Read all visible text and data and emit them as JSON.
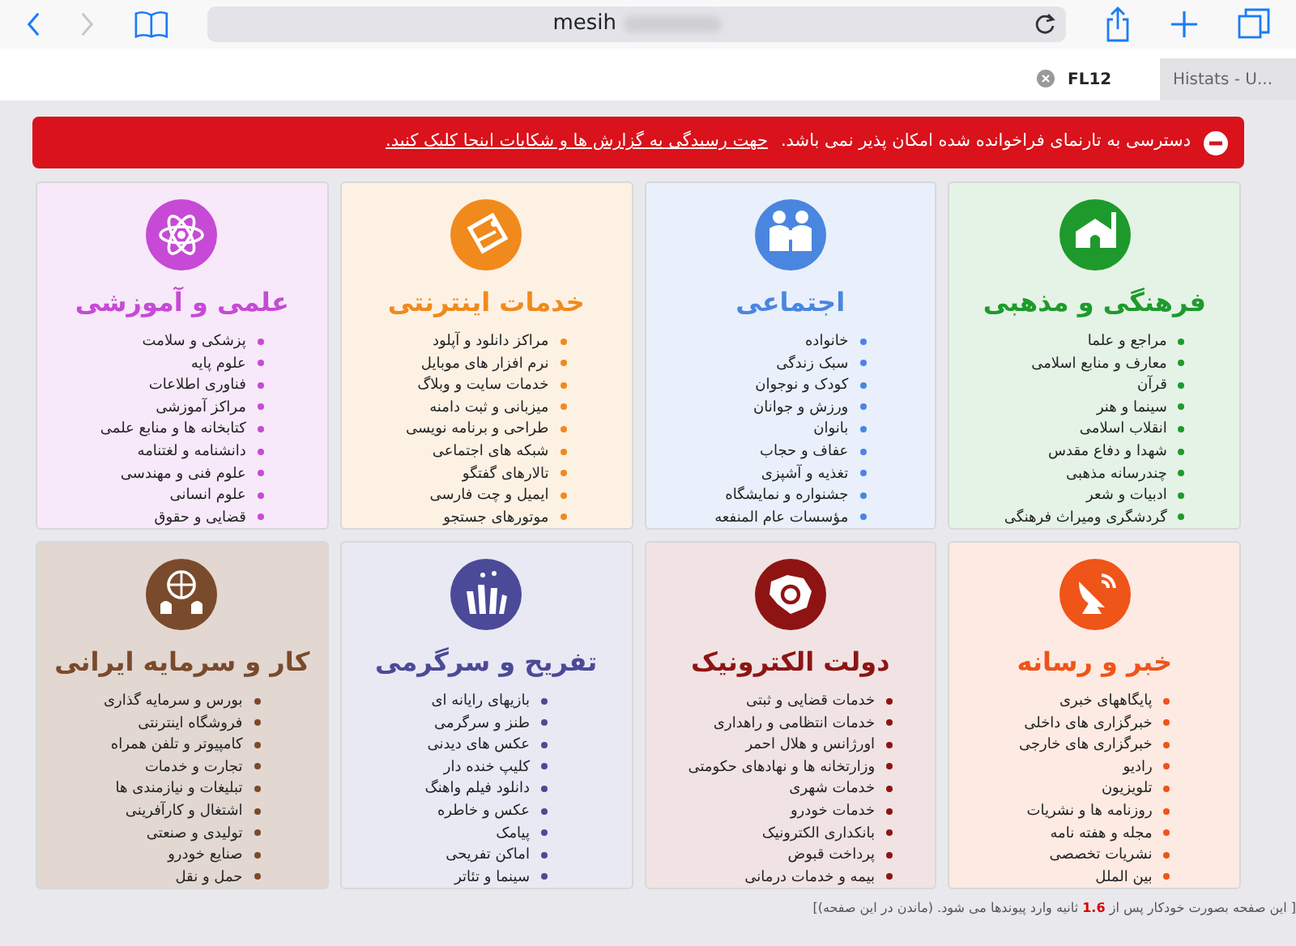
{
  "browser": {
    "back": {
      "disabled": false
    },
    "forward": {
      "disabled": true
    },
    "address": "mesih",
    "tabs": [
      {
        "label": "Histats - U...",
        "selected": false
      },
      {
        "label": "FL12",
        "selected": true
      }
    ]
  },
  "alert": {
    "text": "دسترسی به تارنمای فراخوانده شده امکان پذیر نمی باشد.",
    "link": "جهت رسیدگی به گزارش ها و شکایات اینجا کلیک کنید."
  },
  "categories": [
    {
      "title": "فرهنگی و مذهبی",
      "color": "#1e9a2c",
      "items": [
        "مراجع و علما",
        "معارف و منابع اسلامی",
        "قرآن",
        "سینما و هنر",
        "انقلاب اسلامی",
        "شهدا و دفاع مقدس",
        "چندرسانه مذهبی",
        "ادبیات و شعر",
        "گردشگری ومیراث فرهنگی"
      ]
    },
    {
      "title": "اجتماعی",
      "color": "#4a86df",
      "items": [
        "خانواده",
        "سبک زندگی",
        "کودک و نوجوان",
        "ورزش و جوانان",
        "بانوان",
        "عفاف و حجاب",
        "تغذیه و آشپزی",
        "جشنواره و نمایشگاه",
        "مؤسسات عام المنفعه"
      ]
    },
    {
      "title": "خدمات اینترنتی",
      "color": "#f08a1c",
      "items": [
        "مراکز دانلود و آپلود",
        "نرم افزار های موبایل",
        "خدمات سایت و وبلاگ",
        "میزبانی و ثبت دامنه",
        "طراحی و برنامه نویسی",
        "شبکه های اجتماعی",
        "تالارهای گفتگو",
        "ایمیل و چت فارسی",
        "موتورهای جستجو"
      ]
    },
    {
      "title": "علمی و آموزشی",
      "color": "#c64ad6",
      "items": [
        "پزشکی و سلامت",
        "علوم پایه",
        "فناوری اطلاعات",
        "مراکز آموزشی",
        "کتابخانه ها و منابع علمی",
        "دانشنامه و لغتنامه",
        "علوم فنی و مهندسی",
        "علوم انسانی",
        "قضایی و حقوق"
      ]
    },
    {
      "title": "خبر و رسانه",
      "color": "#ef5418",
      "items": [
        "پایگاههای خبری",
        "خبرگزاری های داخلی",
        "خبرگزاری های خارجی",
        "رادیو",
        "تلویزیون",
        "روزنامه ها و نشریات",
        "مجله و هفته نامه",
        "نشریات تخصصی",
        "بین الملل"
      ]
    },
    {
      "title": "دولت الکترونیک",
      "color": "#8e1414",
      "items": [
        "خدمات قضایی و ثبتی",
        "خدمات انتظامی و راهداری",
        "اورژانس و هلال احمر",
        "وزارتخانه ها و نهادهای حکومتی",
        "خدمات شهری",
        "خدمات خودرو",
        "بانکداری الکترونیک",
        "پرداخت قبوض",
        "بیمه و خدمات درمانی"
      ]
    },
    {
      "title": "تفریح و سرگرمی",
      "color": "#4b4a98",
      "items": [
        "بازیهای رایانه ای",
        "طنز و سرگرمی",
        "عکس های دیدنی",
        "کلیپ خنده دار",
        "دانلود فیلم واهنگ",
        "عکس و خاطره",
        "پیامک",
        "اماکن تفریحی",
        "سینما و تئاتر"
      ]
    },
    {
      "title": "کار و سرمایه ایرانی",
      "color": "#7a4a2c",
      "items": [
        "بورس و سرمایه گذاری",
        "فروشگاه اینترنتی",
        "کامپیوتر و تلفن همراه",
        "تجارت و خدمات",
        "تبلیغات و نیازمندی ها",
        "اشتغال و کارآفرینی",
        "تولیدی و صنعتی",
        "صنایع خودرو",
        "حمل و نقل"
      ]
    }
  ],
  "footer": {
    "open": "[",
    "before": "این صفحه بصورت خودکار پس از",
    "countdown": "1.6",
    "after": "ثانیه وارد پیوندها می شود.",
    "link": "(ماندن در این صفحه)",
    "close": "]"
  }
}
